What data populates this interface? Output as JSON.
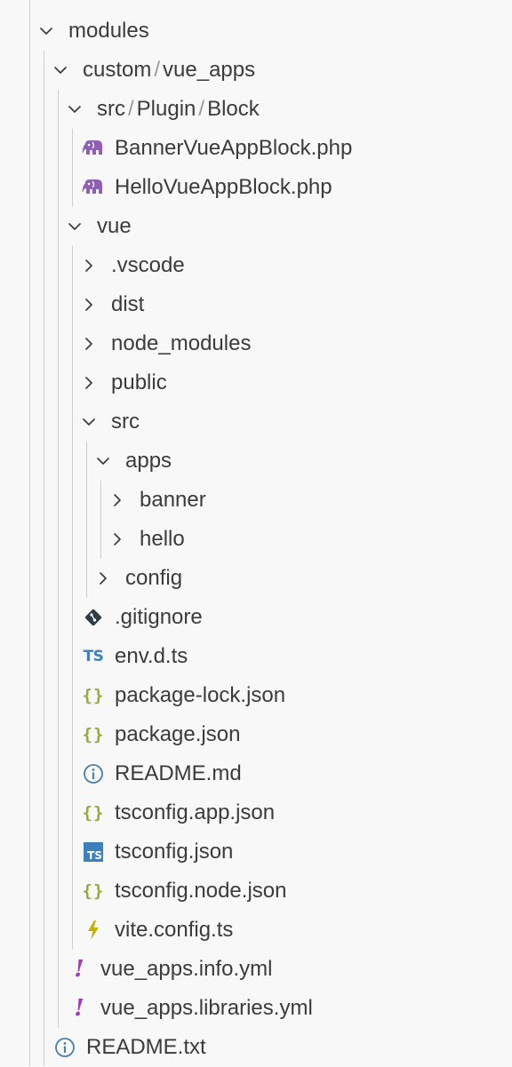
{
  "explorer": {
    "rows": [
      {
        "label": "modules",
        "icon": "chevron-down-icon"
      },
      {
        "parts": [
          "custom",
          "/",
          "vue_apps"
        ],
        "icon": "chevron-down-icon"
      },
      {
        "parts": [
          "src",
          "/",
          "Plugin",
          "/",
          "Block"
        ],
        "icon": "chevron-down-icon"
      },
      {
        "label": "BannerVueAppBlock.php",
        "icon": "php-elephant-icon"
      },
      {
        "label": "HelloVueAppBlock.php",
        "icon": "php-elephant-icon"
      },
      {
        "label": "vue",
        "icon": "chevron-down-icon"
      },
      {
        "label": ".vscode",
        "icon": "chevron-right-icon"
      },
      {
        "label": "dist",
        "icon": "chevron-right-icon"
      },
      {
        "label": "node_modules",
        "icon": "chevron-right-icon"
      },
      {
        "label": "public",
        "icon": "chevron-right-icon"
      },
      {
        "label": "src",
        "icon": "chevron-down-icon"
      },
      {
        "label": "apps",
        "icon": "chevron-down-icon"
      },
      {
        "label": "banner",
        "icon": "chevron-right-icon"
      },
      {
        "label": "hello",
        "icon": "chevron-right-icon"
      },
      {
        "label": "config",
        "icon": "chevron-right-icon"
      },
      {
        "label": ".gitignore",
        "icon": "git-icon"
      },
      {
        "label": "env.d.ts",
        "icon": "typescript-icon",
        "icon_text": "TS"
      },
      {
        "label": "package-lock.json",
        "icon": "json-icon",
        "icon_text": "{}"
      },
      {
        "label": "package.json",
        "icon": "json-icon",
        "icon_text": "{}"
      },
      {
        "label": "README.md",
        "icon": "info-icon"
      },
      {
        "label": "tsconfig.app.json",
        "icon": "json-icon",
        "icon_text": "{}"
      },
      {
        "label": "tsconfig.json",
        "icon": "tsconfig-icon",
        "icon_text": "TS"
      },
      {
        "label": "tsconfig.node.json",
        "icon": "json-icon",
        "icon_text": "{}"
      },
      {
        "label": "vite.config.ts",
        "icon": "vite-icon"
      },
      {
        "label": "vue_apps.info.yml",
        "icon": "yaml-icon",
        "icon_text": "!"
      },
      {
        "label": "vue_apps.libraries.yml",
        "icon": "yaml-icon",
        "icon_text": "!"
      },
      {
        "label": "README.txt",
        "icon": "info-icon"
      }
    ]
  },
  "colors": {
    "php": "#8e5fb5",
    "typescript": "#3d7fbf",
    "json": "#9aa83a",
    "info": "#4a7fa8",
    "yaml": "#9b3db9",
    "vite": "#c4b000",
    "git": "#2f3e46",
    "guide": "#cfcfcf"
  }
}
